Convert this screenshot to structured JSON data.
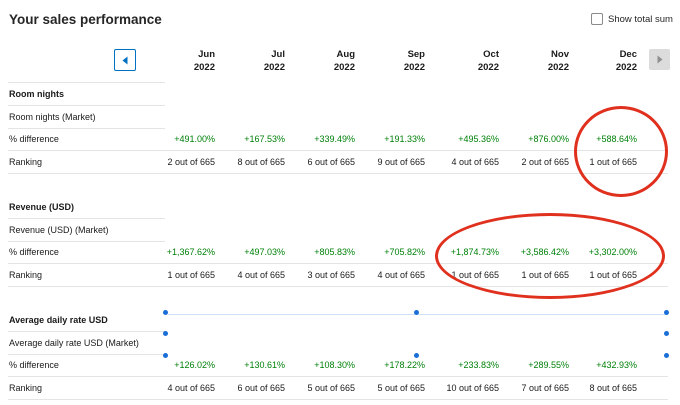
{
  "header": {
    "title": "Your sales performance",
    "show_total_label": "Show total sum",
    "show_total_checked": false
  },
  "nav": {
    "prev_icon": "chevron-left-icon",
    "next_icon": "chevron-right-icon"
  },
  "months": [
    {
      "month": "Jun",
      "year": "2022"
    },
    {
      "month": "Jul",
      "year": "2022"
    },
    {
      "month": "Aug",
      "year": "2022"
    },
    {
      "month": "Sep",
      "year": "2022"
    },
    {
      "month": "Oct",
      "year": "2022"
    },
    {
      "month": "Nov",
      "year": "2022"
    },
    {
      "month": "Dec",
      "year": "2022"
    }
  ],
  "sections": [
    {
      "title": "Room nights",
      "market_label": "Room nights (Market)",
      "diff_label": "% difference",
      "rank_label": "Ranking",
      "diffs": [
        "+491.00%",
        "+167.53%",
        "+339.49%",
        "+191.33%",
        "+495.36%",
        "+876.00%",
        "+588.64%"
      ],
      "rankings": [
        "2 out of 665",
        "8 out of 665",
        "6 out of 665",
        "9 out of 665",
        "4 out of 665",
        "2 out of 665",
        "1 out of 665"
      ]
    },
    {
      "title": "Revenue (USD)",
      "market_label": "Revenue (USD) (Market)",
      "diff_label": "% difference",
      "rank_label": "Ranking",
      "diffs": [
        "+1,367.62%",
        "+497.03%",
        "+805.83%",
        "+705.82%",
        "+1,874.73%",
        "+3,586.42%",
        "+3,302.00%"
      ],
      "rankings": [
        "1 out of 665",
        "4 out of 665",
        "3 out of 665",
        "4 out of 665",
        "1 out of 665",
        "1 out of 665",
        "1 out of 665"
      ]
    },
    {
      "title": "Average daily rate USD",
      "market_label": "Average daily rate USD (Market)",
      "diff_label": "% difference",
      "rank_label": "Ranking",
      "diffs": [
        "+126.02%",
        "+130.61%",
        "+108.30%",
        "+178.22%",
        "+233.83%",
        "+289.55%",
        "+432.93%"
      ],
      "rankings": [
        "4 out of 665",
        "6 out of 665",
        "5 out of 665",
        "5 out of 665",
        "10 out of 665",
        "7 out of 665",
        "8 out of 665"
      ]
    }
  ],
  "colors": {
    "positive": "#008009",
    "accent": "#0071c2",
    "annotation": "#e0301e"
  }
}
